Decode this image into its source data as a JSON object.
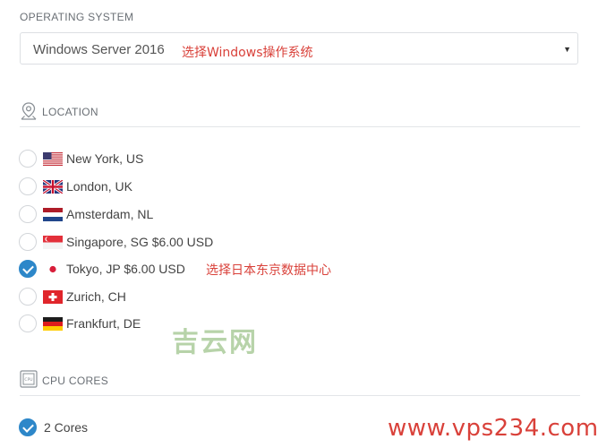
{
  "os": {
    "section_title": "OPERATING SYSTEM",
    "selected_value": "Windows Server 2016",
    "annotation": "选择Windows操作系统",
    "arrow": "▼"
  },
  "location": {
    "section_title": "LOCATION",
    "annotation": "选择日本东京数据中心",
    "options": [
      {
        "label": "New York, US",
        "flag": "us-flag",
        "checked": false
      },
      {
        "label": "London, UK",
        "flag": "uk-flag",
        "checked": false
      },
      {
        "label": "Amsterdam, NL",
        "flag": "nl-flag",
        "checked": false
      },
      {
        "label": "Singapore, SG $6.00 USD",
        "flag": "sg-flag",
        "checked": false
      },
      {
        "label": "Tokyo, JP $6.00 USD",
        "flag": "jp-flag",
        "checked": true
      },
      {
        "label": "Zurich, CH",
        "flag": "ch-flag",
        "checked": false
      },
      {
        "label": "Frankfurt, DE",
        "flag": "de-flag",
        "checked": false
      }
    ]
  },
  "cpu": {
    "section_title": "CPU CORES",
    "icon_text": "CPU",
    "options": [
      {
        "label": "2 Cores",
        "checked": true
      }
    ]
  },
  "watermarks": {
    "site_name": "吉云网",
    "url": "www.vps234.com"
  },
  "colors": {
    "accent": "#2d87c9",
    "annotation_red": "#d9413a",
    "watermark_green": "#b7d3a9"
  }
}
